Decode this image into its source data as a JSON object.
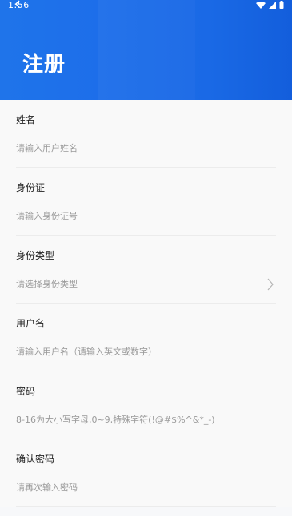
{
  "status_bar": {
    "time": "1:56",
    "wifi_icon": "wifi-icon",
    "signal_icon": "signal-icon",
    "battery_icon": "battery-icon"
  },
  "header": {
    "title": "注册",
    "back_icon": "back-arrow-icon"
  },
  "form": {
    "fields": [
      {
        "label": "姓名",
        "placeholder": "请输入用户姓名",
        "value": ""
      },
      {
        "label": "身份证",
        "placeholder": "请输入身份证号",
        "value": ""
      },
      {
        "label": "身份类型",
        "placeholder": "请选择身份类型",
        "value": "",
        "dropdown_icon": "chevron-right-icon"
      },
      {
        "label": "用户名",
        "placeholder": "请输入用户名（请输入英文或数字）",
        "value": ""
      },
      {
        "label": "密码",
        "placeholder": "8-16为大小写字母,0~9,特殊字符(!@#$%^&*_-)",
        "value": ""
      },
      {
        "label": "确认密码",
        "placeholder": "请再次输入密码",
        "value": ""
      }
    ]
  },
  "colors": {
    "header_blue": "#1667e6",
    "background": "#f9f9f9",
    "divider": "#ececec",
    "placeholder": "#9a9a9a"
  }
}
